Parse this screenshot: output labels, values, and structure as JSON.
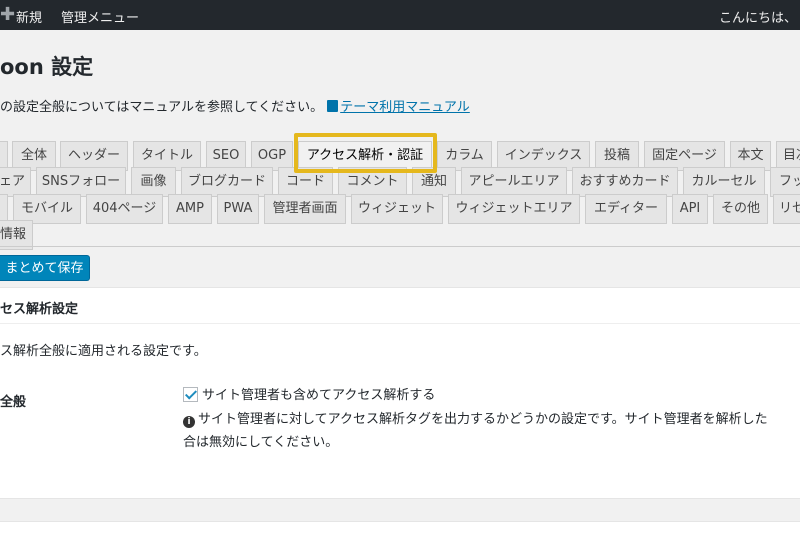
{
  "adminbar": {
    "new_label": "新規",
    "menu_label": "管理メニュー",
    "howdy": "こんにちは、"
  },
  "page": {
    "title": "oon 設定",
    "intro": "の設定全般についてはマニュアルを参照してください。",
    "manual_link": "テーマ利用マニュアル"
  },
  "tabs": {
    "row1": [
      "全体",
      "ヘッダー",
      "タイトル",
      "SEO",
      "OGP",
      "アクセス解析・認証",
      "カラム",
      "インデックス",
      "投稿",
      "固定ページ",
      "本文",
      "目次"
    ],
    "row2": [
      "ェア",
      "SNSフォロー",
      "画像",
      "ブログカード",
      "コード",
      "コメント",
      "通知",
      "アピールエリア",
      "おすすめカード",
      "カルーセル",
      "フッ"
    ],
    "row3": [
      "モバイル",
      "404ページ",
      "AMP",
      "PWA",
      "管理者画面",
      "ウィジェット",
      "ウィジェットエリア",
      "エディター",
      "API",
      "その他",
      "リセ"
    ],
    "row4": [
      "情報"
    ]
  },
  "actions": {
    "save_label": "まとめて保存"
  },
  "section": {
    "title": "セス解析設定",
    "description": "ス解析全般に適用される設定です。",
    "row_label": "全般",
    "checkbox_label": "サイト管理者も含めてアクセス解析する",
    "checkbox_checked": true,
    "help_line1": "サイト管理者に対してアクセス解析タグを出力するかどうかの設定です。サイト管理者を解析した",
    "help_line2": "合は無効にしてください。"
  },
  "colors": {
    "adminbar_bg": "#23282d",
    "primary_button": "#0085ba",
    "link": "#0073aa",
    "highlight_border": "#e5b81d"
  }
}
